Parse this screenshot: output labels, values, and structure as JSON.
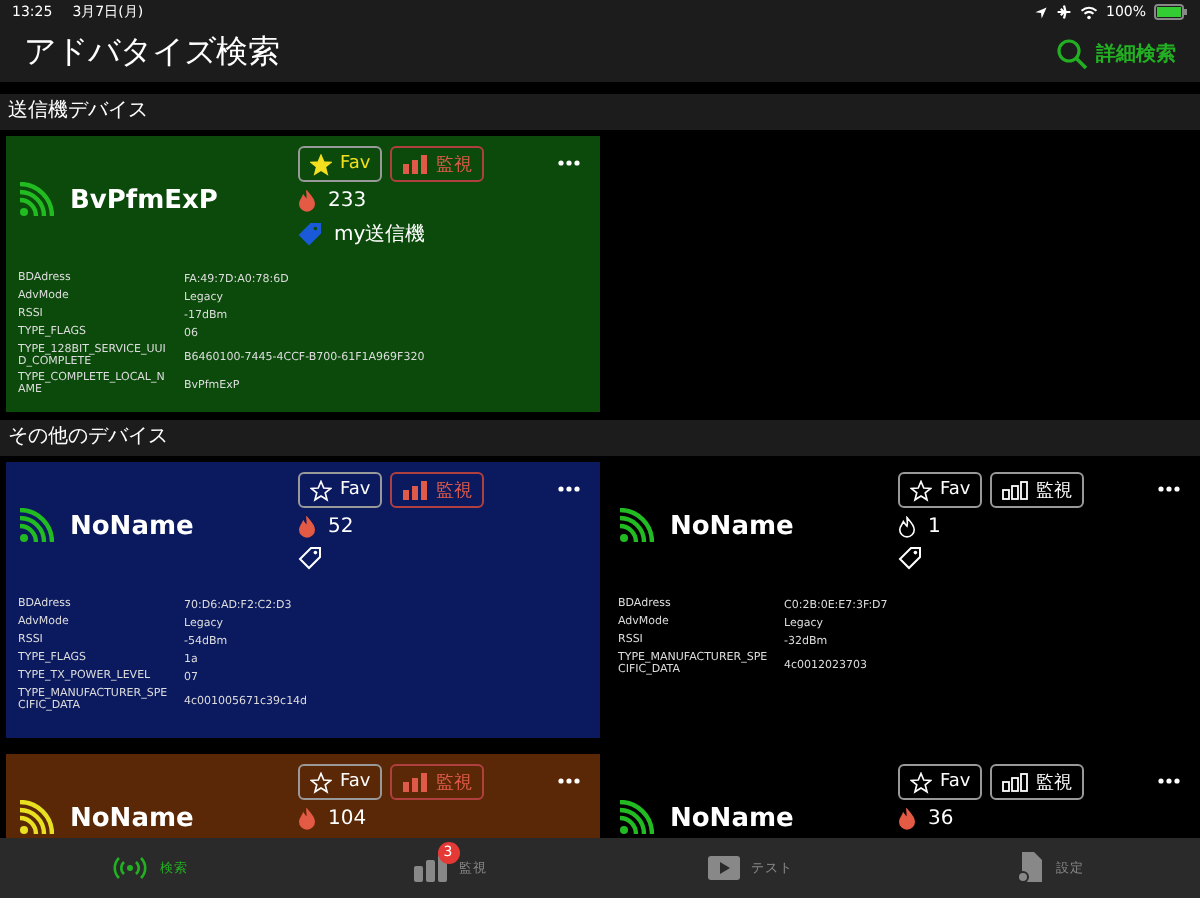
{
  "status_bar": {
    "time": "13:25",
    "date": "3月7日(月)",
    "battery": "100%"
  },
  "nav": {
    "title": "アドバタイズ検索",
    "action": "詳細検索"
  },
  "sections": [
    {
      "title": "送信機デバイス",
      "cards": [
        {
          "name": "BvPfmExP",
          "color": "#0b4a0b",
          "signal": {
            "color": "#22bb22"
          },
          "fav": true,
          "fav_label": "Fav",
          "monitor": true,
          "monitor_label": "監視",
          "hot": true,
          "count": "233",
          "tag_set": true,
          "tag": "my送信機",
          "rows": [
            {
              "label": "BDAdress",
              "value": "FA:49:7D:A0:78:6D"
            },
            {
              "label": "AdvMode",
              "value": "Legacy"
            },
            {
              "label": "RSSI",
              "value": "-17dBm"
            },
            {
              "label": "TYPE_FLAGS",
              "value": "06"
            },
            {
              "label": "TYPE_128BIT_SERVICE_UUID_COMPLETE",
              "value": "B6460100-7445-4CCF-B700-61F1A969F320"
            },
            {
              "label": "TYPE_COMPLETE_LOCAL_NAME",
              "value": "BvPfmExP"
            }
          ]
        }
      ]
    },
    {
      "title": "その他のデバイス",
      "cards": [
        {
          "name": "NoName",
          "color": "#0b1a5e",
          "signal": {
            "color": "#22bb22"
          },
          "fav": false,
          "fav_label": "Fav",
          "monitor": true,
          "monitor_label": "監視",
          "hot": true,
          "count": "52",
          "tag_set": false,
          "rows": [
            {
              "label": "BDAdress",
              "value": "70:D6:AD:F2:C2:D3"
            },
            {
              "label": "AdvMode",
              "value": "Legacy"
            },
            {
              "label": "RSSI",
              "value": "-54dBm"
            },
            {
              "label": "TYPE_FLAGS",
              "value": "1a"
            },
            {
              "label": "TYPE_TX_POWER_LEVEL",
              "value": "07"
            },
            {
              "label": "TYPE_MANUFACTURER_SPECIFIC_DATA",
              "value": "4c001005671c39c14d"
            }
          ]
        },
        {
          "name": "NoName",
          "color": "#000000",
          "signal": {
            "color": "#22bb22"
          },
          "fav": false,
          "fav_label": "Fav",
          "monitor": false,
          "monitor_label": "監視",
          "hot": false,
          "count": "1",
          "tag_set": false,
          "rows": [
            {
              "label": "BDAdress",
              "value": "C0:2B:0E:E7:3F:D7"
            },
            {
              "label": "AdvMode",
              "value": "Legacy"
            },
            {
              "label": "RSSI",
              "value": "-32dBm"
            },
            {
              "label": "TYPE_MANUFACTURER_SPECIFIC_DATA",
              "value": "4c0012023703"
            }
          ]
        },
        {
          "name": "NoName",
          "color": "#5a2806",
          "signal": {
            "color": "#e8e020"
          },
          "fav": false,
          "fav_label": "Fav",
          "monitor": true,
          "monitor_label": "監視",
          "hot": true,
          "count": "104"
        },
        {
          "name": "NoName",
          "color": "#000000",
          "signal": {
            "color": "#22bb22"
          },
          "fav": false,
          "fav_label": "Fav",
          "monitor": false,
          "monitor_label": "監視",
          "hot": true,
          "count": "36"
        }
      ]
    }
  ],
  "tab_bar": [
    {
      "label": "検索",
      "selected": true
    },
    {
      "label": "監視",
      "selected": false,
      "badge": "3"
    },
    {
      "label": "テスト",
      "selected": false
    },
    {
      "label": "設定",
      "selected": false
    }
  ]
}
